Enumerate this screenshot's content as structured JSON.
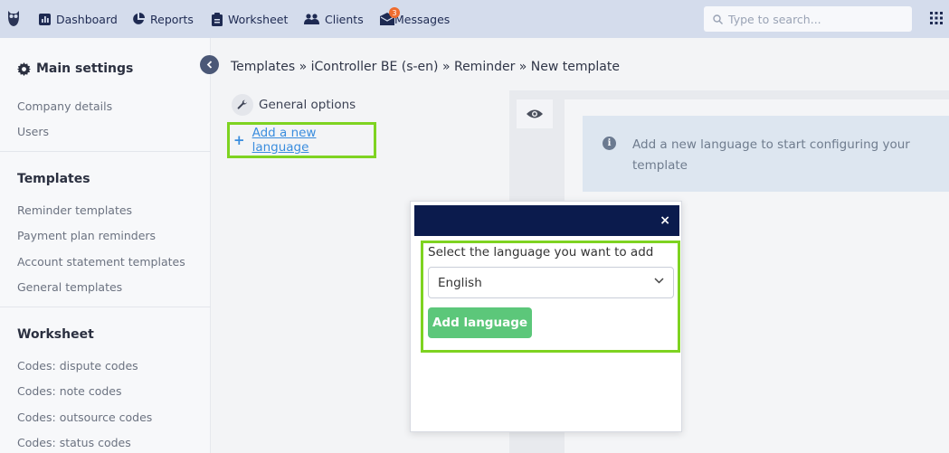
{
  "nav": {
    "items": [
      {
        "label": "Dashboard",
        "icon": "dashboard-icon"
      },
      {
        "label": "Reports",
        "icon": "pie-chart-icon"
      },
      {
        "label": "Worksheet",
        "icon": "clipboard-icon"
      },
      {
        "label": "Clients",
        "icon": "users-icon"
      },
      {
        "label": "Messages",
        "icon": "messages-icon"
      }
    ],
    "messages_badge": "3",
    "search_placeholder": "Type to search..."
  },
  "sidebar": {
    "main_title": "Main settings",
    "general_links": [
      "Company details",
      "Users"
    ],
    "templates_head": "Templates",
    "template_links": [
      "Reminder templates",
      "Payment plan reminders",
      "Account statement templates",
      "General templates"
    ],
    "worksheet_head": "Worksheet",
    "worksheet_links": [
      "Codes: dispute codes",
      "Codes: note codes",
      "Codes: outsource codes",
      "Codes: status codes"
    ]
  },
  "breadcrumb": "Templates » iController BE (s-en) » Reminder » New template",
  "general_options": "General options",
  "add_language_link": "Add a new language",
  "info_message": "Add a new language to start configuring your template",
  "modal": {
    "close": "×",
    "label": "Select the language you want to add",
    "selected_language": "English",
    "button": "Add language"
  },
  "colors": {
    "navbar": "#d4dcec",
    "modal_header": "#0b1b4d",
    "highlight": "#7ed321",
    "button_green": "#5cc77a",
    "link_blue": "#3a8dde",
    "info_bg": "#dde6f0"
  }
}
